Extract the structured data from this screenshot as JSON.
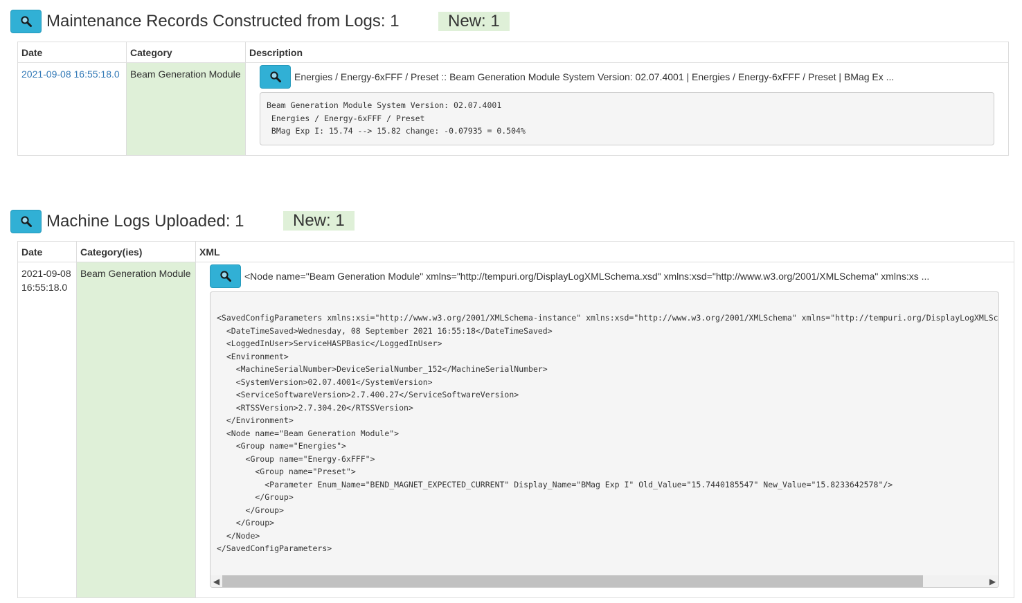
{
  "maintenance": {
    "title": "Maintenance Records Constructed from Logs: 1",
    "new_badge": "New: 1",
    "columns": [
      "Date",
      "Category",
      "Description"
    ],
    "rows": [
      {
        "date": "2021-09-08 16:55:18.0",
        "category": "Beam Generation Module",
        "summary": "Energies / Energy-6xFFF / Preset :: Beam Generation Module System Version: 02.07.4001 | Energies / Energy-6xFFF / Preset | BMag Ex ...",
        "detail": "Beam Generation Module System Version: 02.07.4001\n Energies / Energy-6xFFF / Preset\n BMag Exp I: 15.74 --> 15.82 change: -0.07935 = 0.504%"
      }
    ]
  },
  "machine_logs": {
    "title": "Machine Logs Uploaded: 1",
    "new_badge": "New: 1",
    "columns": [
      "Date",
      "Category(ies)",
      "XML"
    ],
    "rows": [
      {
        "date_line1": "2021-09-08",
        "date_line2": "16:55:18.0",
        "category": "Beam Generation Module",
        "summary": "<Node name=\"Beam Generation Module\" xmlns=\"http://tempuri.org/DisplayLogXMLSchema.xsd\" xmlns:xsd=\"http://www.w3.org/2001/XMLSchema\" xmlns:xs ...",
        "xml": "<SavedConfigParameters xmlns:xsi=\"http://www.w3.org/2001/XMLSchema-instance\" xmlns:xsd=\"http://www.w3.org/2001/XMLSchema\" xmlns=\"http://tempuri.org/DisplayLogXMLSchema.xsd\">\n  <DateTimeSaved>Wednesday, 08 September 2021 16:55:18</DateTimeSaved>\n  <LoggedInUser>ServiceHASPBasic</LoggedInUser>\n  <Environment>\n    <MachineSerialNumber>DeviceSerialNumber_152</MachineSerialNumber>\n    <SystemVersion>02.07.4001</SystemVersion>\n    <ServiceSoftwareVersion>2.7.400.27</ServiceSoftwareVersion>\n    <RTSSVersion>2.7.304.20</RTSSVersion>\n  </Environment>\n  <Node name=\"Beam Generation Module\">\n    <Group name=\"Energies\">\n      <Group name=\"Energy-6xFFF\">\n        <Group name=\"Preset\">\n          <Parameter Enum_Name=\"BEND_MAGNET_EXPECTED_CURRENT\" Display_Name=\"BMag Exp I\" Old_Value=\"15.7440185547\" New_Value=\"15.8233642578\"/>\n        </Group>\n      </Group>\n    </Group>\n  </Node>\n</SavedConfigParameters>"
      }
    ]
  },
  "icons": {
    "search": "magnifier-icon",
    "scroll_left": "◀",
    "scroll_right": "▶"
  },
  "colors": {
    "button": "#31b0d5",
    "category_bg": "#dff0d8",
    "link": "#337ab7"
  }
}
